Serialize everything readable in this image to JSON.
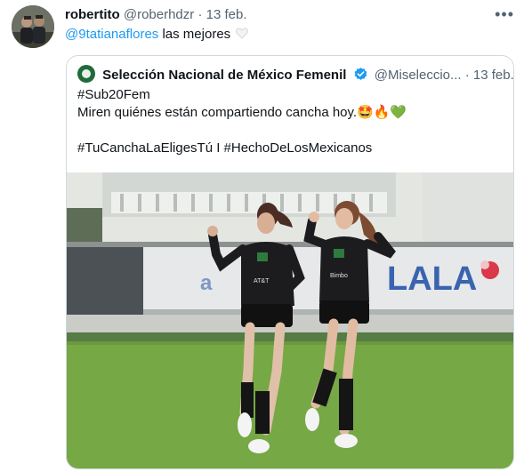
{
  "author": {
    "name": "robertito",
    "handle": "@roberhdzr",
    "separator": "·",
    "date": "13 feb."
  },
  "tweet": {
    "mention": "@9tatianaflores",
    "text": " las mejores"
  },
  "more_label": "•••",
  "quoted": {
    "name": "Selección Nacional de México Femenil",
    "handle": "@Miseleccio...",
    "separator": "·",
    "date": "13 feb.",
    "line1": "#Sub20Fem",
    "line2": "Miren quiénes están compartiendo cancha hoy.🤩🔥💚",
    "line3": "#TuCanchaLaEligesTú I #HechoDeLosMexicanos"
  },
  "photo": {
    "banner_text": "LALA",
    "jersey_text": "AT&T"
  }
}
